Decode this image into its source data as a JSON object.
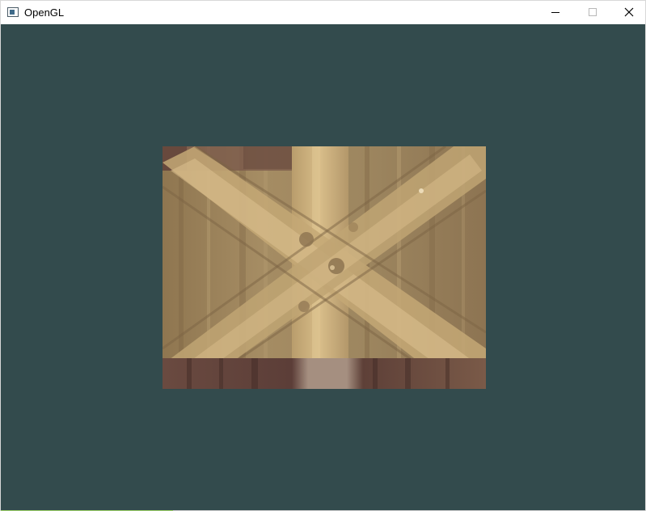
{
  "window": {
    "title": "OpenGL",
    "icon": "app-window-icon"
  },
  "controls": {
    "minimize_icon": "minimize-icon",
    "maximize_icon": "maximize-icon",
    "close_icon": "close-icon"
  },
  "viewport": {
    "clear_color": "#334b4d",
    "content": "textured-quad"
  },
  "colors": {
    "wood_base": "#a8926a",
    "wood_light": "#d3b884",
    "wood_dark": "#5a3b32",
    "titlebar": "#ffffff"
  }
}
